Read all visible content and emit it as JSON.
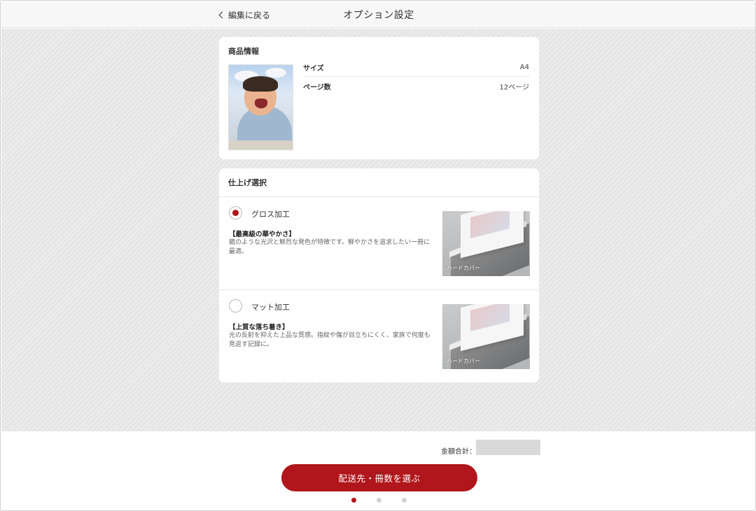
{
  "header": {
    "back_label": "編集に戻る",
    "title": "オプション設定"
  },
  "product_info": {
    "title": "商品情報",
    "rows": [
      {
        "label": "サイズ",
        "value": "A4"
      },
      {
        "label": "ページ数",
        "value": "12ページ"
      }
    ]
  },
  "finish": {
    "title": "仕上げ選択",
    "options": [
      {
        "name": "グロス加工",
        "selected": true,
        "headline": "【最高級の華やかさ】",
        "description": "鏡のような光沢と鮮烈な発色が特徴です。鮮やかさを追求したい一冊に最適。",
        "image_caption": "ハードカバー"
      },
      {
        "name": "マット加工",
        "selected": false,
        "headline": "【上質な落ち着き】",
        "description": "光の反射を抑えた上品な質感。指紋や傷が目立ちにくく、家族で何度も見返す記録に。",
        "image_caption": "ハードカバー"
      }
    ]
  },
  "footer": {
    "total_label": "金額合計：",
    "cta_label": "配送先・冊数を選ぶ",
    "pager": {
      "count": 3,
      "active_index": 0
    }
  },
  "colors": {
    "accent": "#b0161b",
    "header_bg": "#f7f7f7",
    "content_bg": "#e9e9e9"
  }
}
